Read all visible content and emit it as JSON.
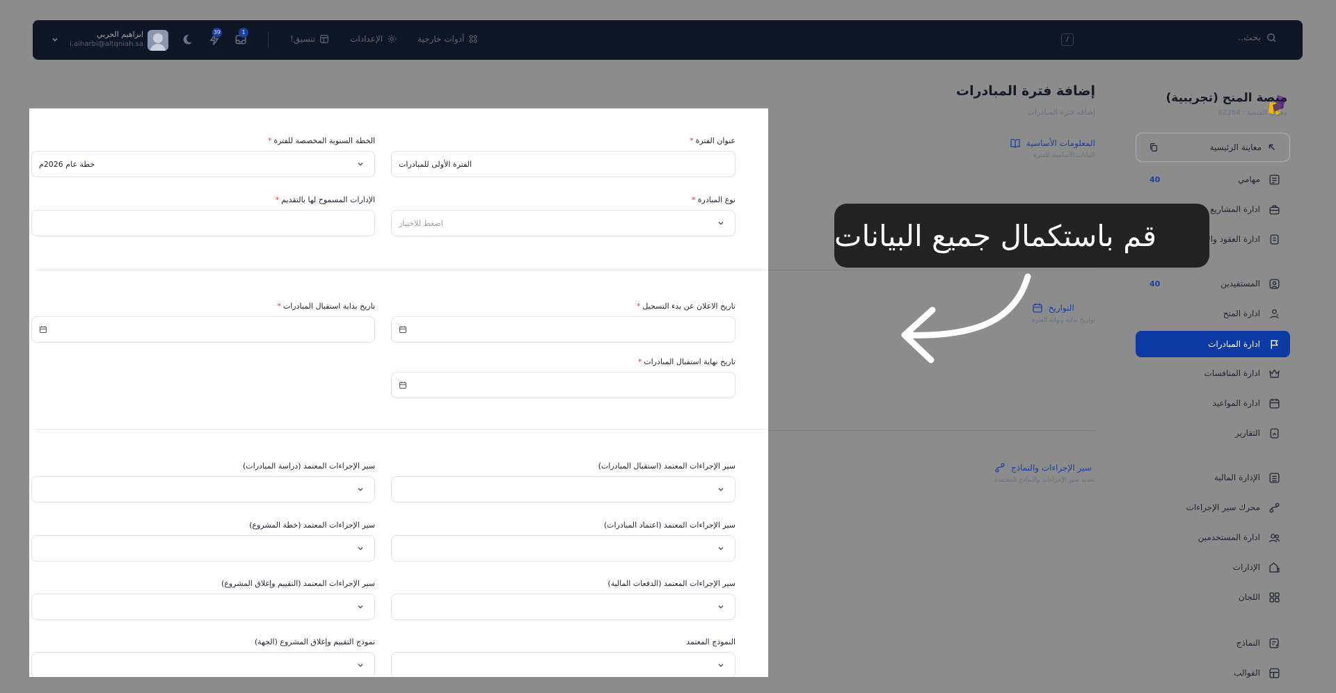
{
  "topbar": {
    "search_placeholder": "بحث..",
    "kbd": "/",
    "links": [
      {
        "label": "تنسيق!",
        "icon": "layout-icon"
      },
      {
        "label": "الإعدادات",
        "icon": "gear-icon"
      },
      {
        "label": "أدوات خارجية",
        "icon": "apps-icon"
      }
    ],
    "messages_badge": "1",
    "notifications_badge": "39",
    "user_name": "ابراهيم الحربي",
    "user_email": "i.alharbi@altqniah.sa"
  },
  "sidebar": {
    "brand_title": "منصة المنح (تجريبية)",
    "brand_sub": "معرّف المنصة : 82384",
    "preview_label": "معاينة الرئيسية",
    "items": [
      {
        "label": "مهامي",
        "count": "40",
        "icon": "tasks-icon"
      },
      {
        "label": "ادارة المشاريع",
        "count": "",
        "icon": "briefcase-icon"
      },
      {
        "label": "ادارة العقود والاتفاقيات",
        "count": "",
        "icon": "contract-icon"
      },
      {
        "label": "المستفيدين",
        "count": "40",
        "icon": "user-circle-icon"
      },
      {
        "label": "ادارة المنح",
        "count": "",
        "icon": "grant-icon"
      },
      {
        "label": "ادارة المبادرات",
        "count": "",
        "icon": "flag-icon"
      },
      {
        "label": "ادارة المنافسات",
        "count": "",
        "icon": "crown-icon"
      },
      {
        "label": "ادارة المواعيد",
        "count": "",
        "icon": "calendar-icon"
      },
      {
        "label": "التقارير",
        "count": "",
        "icon": "report-icon"
      },
      {
        "label": "الإدارة المالية",
        "count": "",
        "icon": "finance-icon"
      },
      {
        "label": "محرك سير الإجراءات",
        "count": "",
        "icon": "workflow-icon"
      },
      {
        "label": "ادارة المستخدمين",
        "count": "",
        "icon": "users-icon"
      },
      {
        "label": "الإدارات",
        "count": "",
        "icon": "departments-icon"
      },
      {
        "label": "اللجان",
        "count": "",
        "icon": "grid-icon"
      },
      {
        "label": "النماذج",
        "count": "",
        "icon": "form-icon"
      },
      {
        "label": "القوالب",
        "count": "",
        "icon": "template-icon"
      }
    ]
  },
  "page": {
    "title": "إضافة فترة المبادرات",
    "subtitle": "إضافة فترة المبادرات",
    "sections": [
      {
        "title": "المعلومات الأساسية",
        "desc": "البيانات الأساسية للفترة"
      },
      {
        "title": "التواريخ",
        "desc": "تواريخ بداية ونهاية الفترة"
      },
      {
        "title": "سير الإجراءات والنماذج",
        "desc": "تحديد سير الإجراءات والنماذج المعتمدة"
      }
    ]
  },
  "form": {
    "period_title": {
      "label": "عنوان الفترة",
      "value": "الفترة الأولى للمبادرات"
    },
    "annual_plan": {
      "label": "الخطة السنوية المخصصة للفترة",
      "value": "خطة عام 2026م"
    },
    "initiative_type": {
      "label": "نوع المبادرة",
      "placeholder": "اضغط للاختيار"
    },
    "allowed_departments": {
      "label": "الإدارات المسموح لها بالتقديم"
    },
    "announce_date": {
      "label": "تاريخ الاعلان عن بدء التسجيل"
    },
    "receive_start": {
      "label": "تاريخ بداية استقبال المبادرات"
    },
    "receive_end": {
      "label": "تاريخ نهاية استقبال المبادرات"
    },
    "wf_receive": {
      "label": "سير الإجراءات المعتمد (استقبال المبادرات)"
    },
    "wf_study": {
      "label": "سير الإجراءات المعتمد (دراسة المبادرات)"
    },
    "wf_approve": {
      "label": "سير الإجراءات المعتمد (اعتماد المبادرات)"
    },
    "wf_plan": {
      "label": "سير الإجراءات المعتمد (خطة المشروع)"
    },
    "wf_payments": {
      "label": "سير الإجراءات المعتمد (الدفعات المالية)"
    },
    "wf_close": {
      "label": "سير الإجراءات المعتمد (التقييم وإغلاق المشروع)"
    },
    "approved_form": {
      "label": "النموذج المعتمد"
    },
    "close_form": {
      "label": "نموذج التقييم وإغلاق المشروع (الجهة)"
    }
  },
  "callout": {
    "text": "قم باستكمال جميع البيانات"
  }
}
